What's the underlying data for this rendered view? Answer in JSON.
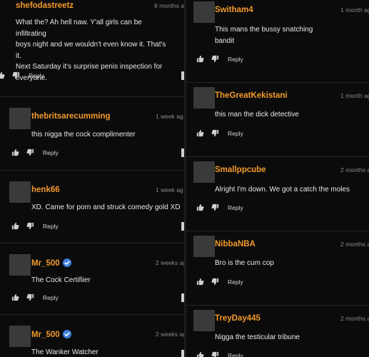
{
  "left_comments": [
    {
      "username": "shefodastreetz",
      "verified": false,
      "time": "8 months ag",
      "body": "What the? Ah hell naw. Y'all girls can be infiltrating\nboys night and we wouldn't even know it. That's it.\nNext Saturday it's surprise penis inspection for\neveryone.",
      "reply_label": "Reply"
    },
    {
      "username": "thebritsarecumming",
      "verified": false,
      "time": "1 week ag",
      "body": "this nigga the cock complimenter",
      "reply_label": "Reply"
    },
    {
      "username": "henk66",
      "verified": false,
      "time": "1 week ag",
      "body": "XD. Came for porn and struck comedy gold XD",
      "reply_label": "Reply"
    },
    {
      "username": "Mr_500",
      "verified": true,
      "time": "2 weeks ag",
      "body": "The Cock Certifiier",
      "reply_label": "Reply"
    },
    {
      "username": "Mr_500",
      "verified": true,
      "time": "2 weeks ag",
      "body": "The Wanker Watcher",
      "reply_label": ""
    }
  ],
  "right_comments": [
    {
      "username": "Switham4",
      "time": "1 month ag",
      "body": "This mans the bussy snatching\nbandit",
      "reply_label": "Reply"
    },
    {
      "username": "TheGreatKekistani",
      "time": "1 month ag",
      "body": "this man the dick detective",
      "reply_label": "Reply"
    },
    {
      "username": "Smallppcube",
      "time": "2 months ag",
      "body": "Alright I'm down. We got a catch the moles",
      "reply_label": "Reply"
    },
    {
      "username": "NibbaNBA",
      "time": "2 months ag",
      "body": "Bro is the cum cop",
      "reply_label": "Reply"
    },
    {
      "username": "TreyDay445",
      "time": "2 months ag",
      "body": "Nigga the testicular tribune",
      "reply_label": "Reply"
    }
  ],
  "icons": {
    "thumbs_up": "thumbs-up-icon",
    "thumbs_down": "thumbs-down-icon",
    "verified": "verified-badge-icon",
    "more": "more-options-icon"
  },
  "colors": {
    "username": "#f39a2c",
    "background": "#0b0b0b",
    "verified": "#3d7fe0"
  }
}
